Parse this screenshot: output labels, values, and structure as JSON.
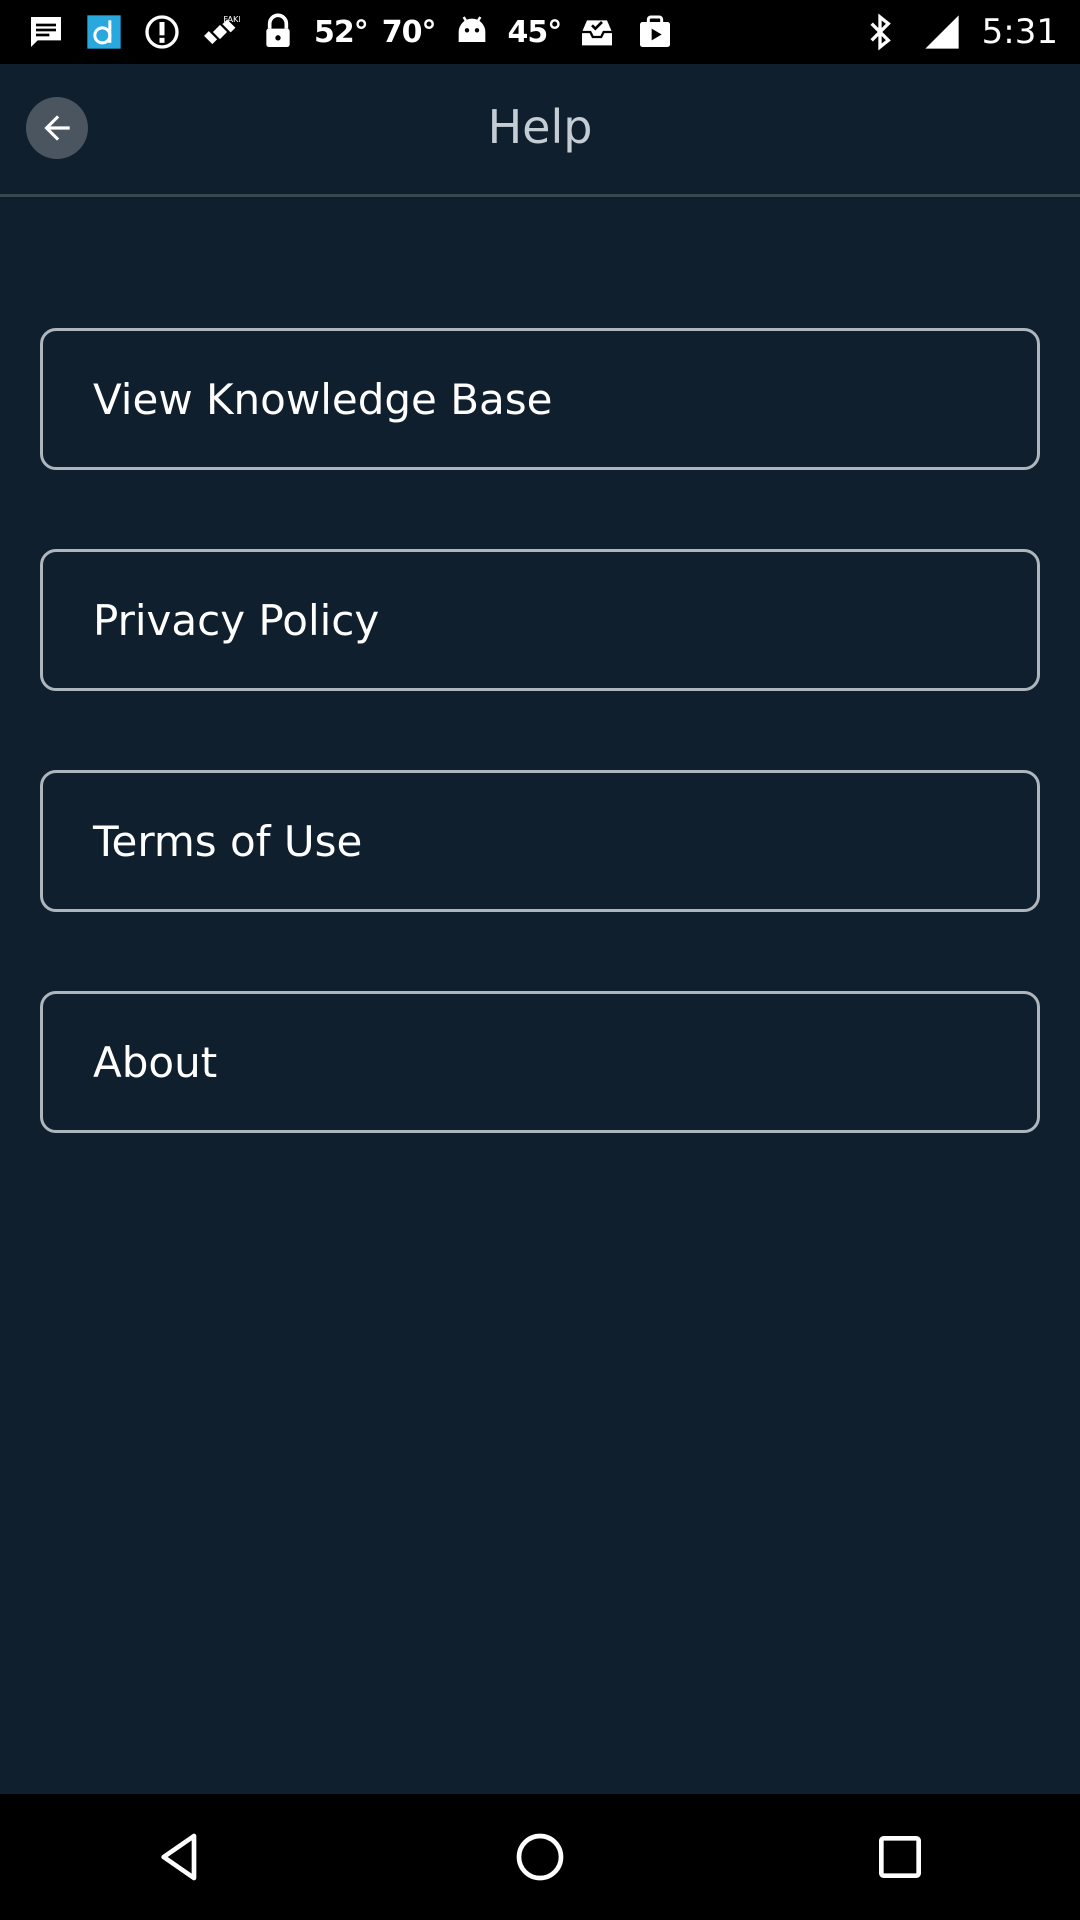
{
  "status_bar": {
    "temps": [
      "52°",
      "70°",
      "45°"
    ],
    "time": "5:31",
    "icons": [
      "message-icon",
      "app-d-icon",
      "info-icon",
      "fake-gps-satellite-icon",
      "lock-icon",
      "android-icon",
      "inbox-icon",
      "play-store-icon",
      "bluetooth-icon",
      "signal-icon"
    ]
  },
  "header": {
    "title": "Help",
    "back_icon": "arrow-back-icon"
  },
  "menu": {
    "items": [
      {
        "label": "View Knowledge Base"
      },
      {
        "label": "Privacy Policy"
      },
      {
        "label": "Terms of Use"
      },
      {
        "label": "About"
      }
    ]
  },
  "nav_bar": {
    "icons": [
      "back-triangle-icon",
      "home-circle-icon",
      "recents-square-icon"
    ]
  },
  "colors": {
    "background": "#0f1f2d",
    "border": "#aeb6bd",
    "title": "#c4ccd4"
  }
}
